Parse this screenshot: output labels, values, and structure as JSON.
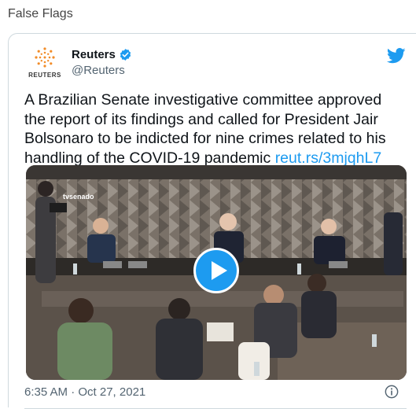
{
  "page": {
    "label": "False Flags"
  },
  "tweet": {
    "display_name": "Reuters",
    "handle": "@Reuters",
    "avatar_word": "REUTERS",
    "text": "A Brazilian Senate investigative committee approved the report of its findings and called for President Jair Bolsonaro to be indicted for nine crimes related to his handling of the COVID-19 pandemic ",
    "link_text": "reut.rs/3mjqhL7",
    "timestamp": "6:35 AM · Oct 27, 2021",
    "media_watermark": "tvsenado"
  },
  "colors": {
    "accent": "#1d9bf0",
    "avatar_orange": "#f28c28"
  },
  "icons": [
    "verified-badge-icon",
    "twitter-bird-icon",
    "play-icon",
    "info-icon"
  ]
}
